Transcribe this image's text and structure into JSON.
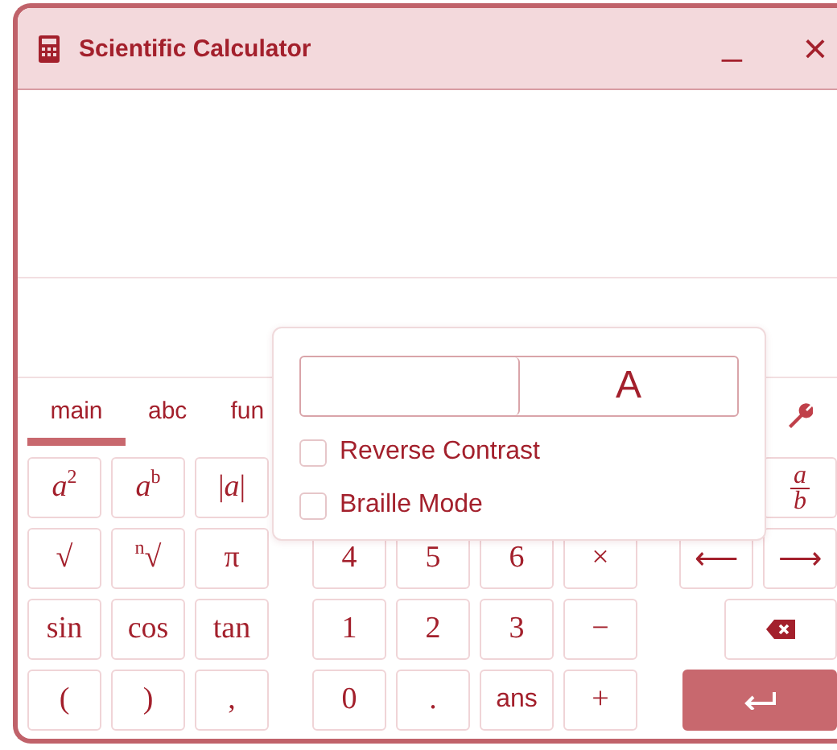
{
  "window": {
    "title": "Scientific Calculator",
    "minimize": "_",
    "close": "×"
  },
  "tabs": [
    {
      "label": "main",
      "selected": true
    },
    {
      "label": "abc",
      "selected": false
    },
    {
      "label": "fun",
      "selected": false
    }
  ],
  "keypad": {
    "rows": [
      {
        "left": [
          {
            "kind": "math",
            "label": "*a*$^{2}$"
          },
          {
            "kind": "math",
            "label": "*a*$^{b}$"
          },
          {
            "kind": "math",
            "label": "|*a*|"
          }
        ],
        "middle": [],
        "right": [
          {
            "kind": "fraction",
            "numerator": "a",
            "denominator": "b"
          }
        ]
      },
      {
        "left": [
          {
            "kind": "math",
            "label": "√"
          },
          {
            "kind": "math",
            "label": "$^{n}$√"
          },
          {
            "kind": "math",
            "label": "π"
          }
        ],
        "middle": [
          {
            "kind": "math",
            "label": "4"
          },
          {
            "kind": "math",
            "label": "5"
          },
          {
            "kind": "math",
            "label": "6"
          },
          {
            "kind": "math",
            "label": "×"
          }
        ],
        "right": [
          {
            "kind": "math",
            "label": "⟵"
          },
          {
            "kind": "math",
            "label": "⟶"
          }
        ]
      },
      {
        "left": [
          {
            "kind": "math",
            "label": "sin"
          },
          {
            "kind": "math",
            "label": "cos"
          },
          {
            "kind": "math",
            "label": "tan"
          }
        ],
        "middle": [
          {
            "kind": "math",
            "label": "1"
          },
          {
            "kind": "math",
            "label": "2"
          },
          {
            "kind": "math",
            "label": "3"
          },
          {
            "kind": "math",
            "label": "−"
          }
        ],
        "right": [
          {
            "kind": "backspace"
          }
        ]
      },
      {
        "left": [
          {
            "kind": "math",
            "label": "("
          },
          {
            "kind": "math",
            "label": ")"
          },
          {
            "kind": "math",
            "label": ","
          }
        ],
        "middle": [
          {
            "kind": "math",
            "label": "0"
          },
          {
            "kind": "math",
            "label": "."
          },
          {
            "kind": "sans",
            "label": "ans"
          },
          {
            "kind": "math",
            "label": "+"
          }
        ],
        "right": [
          {
            "kind": "enter"
          }
        ]
      }
    ]
  },
  "settings_popup": {
    "font_size_label": "A",
    "options": [
      {
        "label": "Reverse Contrast",
        "checked": false
      },
      {
        "label": "Braille Mode",
        "checked": false
      }
    ]
  }
}
